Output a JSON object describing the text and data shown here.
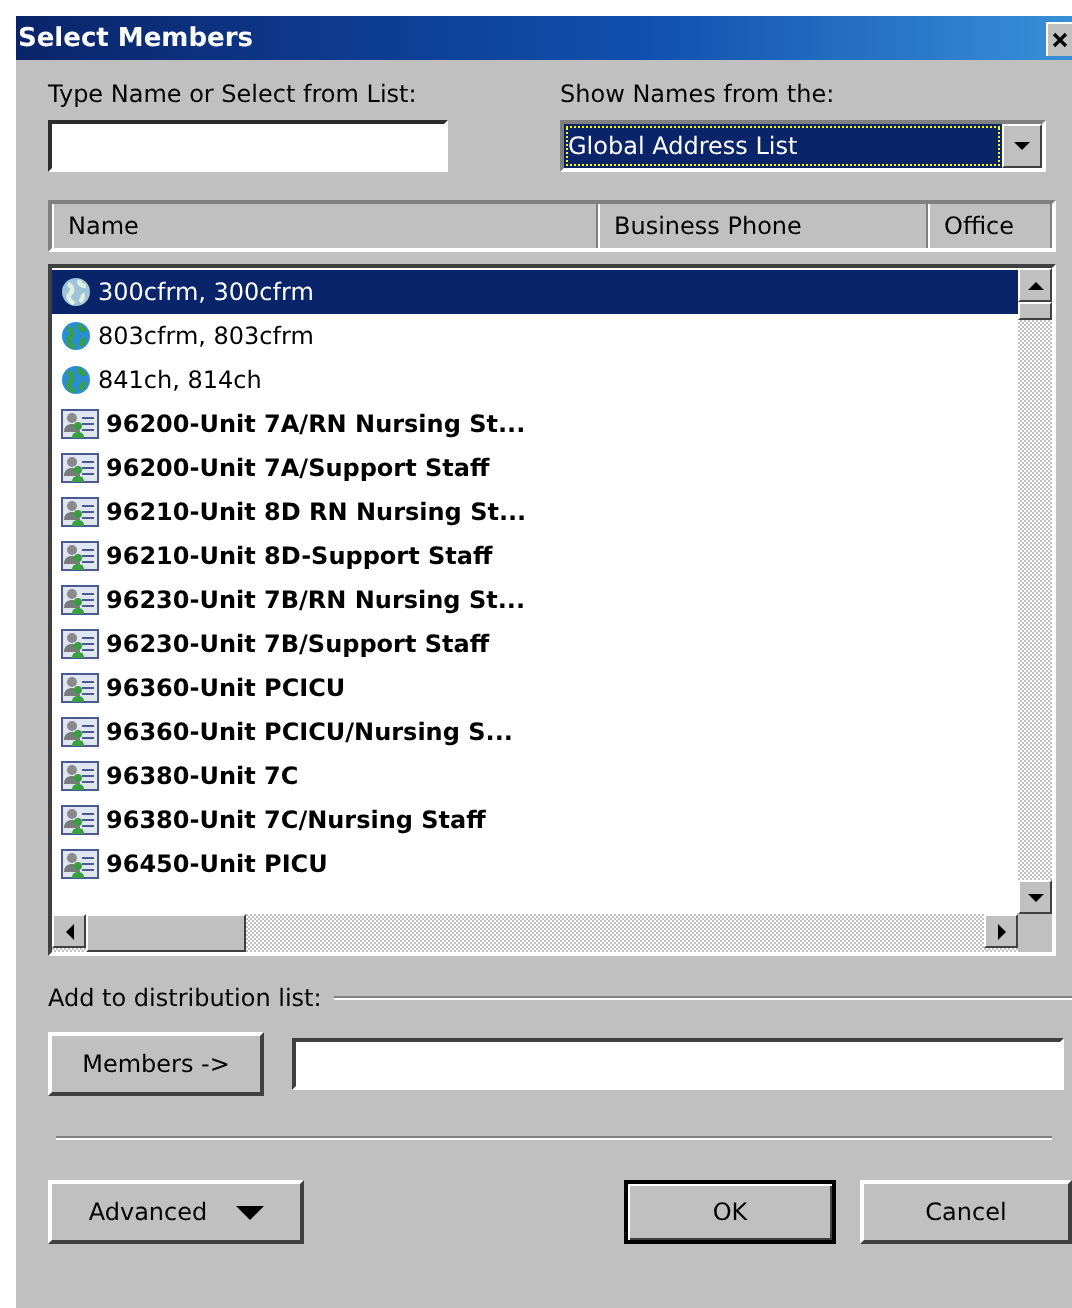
{
  "window": {
    "title": "Select Members"
  },
  "type_name": {
    "label": "Type Name or Select from List:"
  },
  "show_names": {
    "label": "Show Names from the:",
    "value": "Global Address List"
  },
  "table": {
    "columns": [
      "Name",
      "Business Phone",
      "Office"
    ],
    "rows": [
      {
        "kind": "globe",
        "name": "300cfrm, 300cfrm",
        "selected": true
      },
      {
        "kind": "globe",
        "name": "803cfrm, 803cfrm",
        "selected": false
      },
      {
        "kind": "globe",
        "name": "841ch, 814ch",
        "selected": false
      },
      {
        "kind": "group",
        "name": "96200-Unit 7A/RN Nursing St...",
        "selected": false
      },
      {
        "kind": "group",
        "name": "96200-Unit 7A/Support Staff",
        "selected": false
      },
      {
        "kind": "group",
        "name": "96210-Unit 8D RN Nursing St...",
        "selected": false
      },
      {
        "kind": "group",
        "name": "96210-Unit 8D-Support Staff",
        "selected": false
      },
      {
        "kind": "group",
        "name": "96230-Unit 7B/RN Nursing St...",
        "selected": false
      },
      {
        "kind": "group",
        "name": "96230-Unit 7B/Support Staff",
        "selected": false
      },
      {
        "kind": "group",
        "name": "96360-Unit PCICU",
        "selected": false
      },
      {
        "kind": "group",
        "name": "96360-Unit PCICU/Nursing S...",
        "selected": false
      },
      {
        "kind": "group",
        "name": "96380-Unit 7C",
        "selected": false
      },
      {
        "kind": "group",
        "name": "96380-Unit 7C/Nursing Staff",
        "selected": false
      },
      {
        "kind": "group",
        "name": "96450-Unit PICU",
        "selected": false
      }
    ]
  },
  "distribution": {
    "label": "Add to distribution list:",
    "button": "Members ->"
  },
  "buttons": {
    "advanced": "Advanced",
    "ok": "OK",
    "cancel": "Cancel"
  }
}
